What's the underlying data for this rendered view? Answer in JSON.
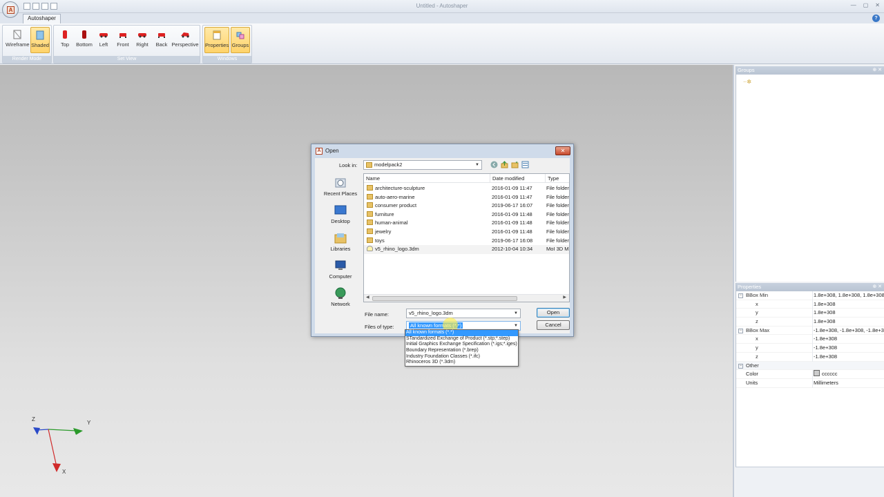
{
  "window": {
    "title": "Untitled - Autoshaper",
    "app_letter": "A"
  },
  "ribbon": {
    "tab": "Autoshaper",
    "groups": [
      {
        "label": "Render Mode",
        "buttons": [
          "Wireframe",
          "Shaded"
        ]
      },
      {
        "label": "Set View",
        "buttons": [
          "Top",
          "Bottom",
          "Left",
          "Front",
          "Right",
          "Back",
          "Perspective"
        ]
      },
      {
        "label": "Windows",
        "buttons": [
          "Properties",
          "Groups"
        ]
      }
    ]
  },
  "panels": {
    "groups_title": "Groups",
    "properties_title": "Properties",
    "properties": [
      {
        "key": "BBox Min",
        "value": "1.8e+308, 1.8e+308, 1.8e+308",
        "level": "cat"
      },
      {
        "key": "x",
        "value": "1.8e+308",
        "level": "sub"
      },
      {
        "key": "y",
        "value": "1.8e+308",
        "level": "sub"
      },
      {
        "key": "z",
        "value": "1.8e+308",
        "level": "sub"
      },
      {
        "key": "BBox Max",
        "value": "-1.8e+308, -1.8e+308, -1.8e+308",
        "level": "cat"
      },
      {
        "key": "x",
        "value": "-1.8e+308",
        "level": "sub"
      },
      {
        "key": "y",
        "value": "-1.8e+308",
        "level": "sub"
      },
      {
        "key": "z",
        "value": "-1.8e+308",
        "level": "sub"
      },
      {
        "key": "Other",
        "value": "",
        "level": "cat"
      },
      {
        "key": "Color",
        "value": "cccccc",
        "level": "plain"
      },
      {
        "key": "Units",
        "value": "Millimeters",
        "level": "plain"
      }
    ]
  },
  "dialog": {
    "title": "Open",
    "look_in_label": "Look in:",
    "look_in_value": "modelpack2",
    "places": [
      "Recent Places",
      "Desktop",
      "Libraries",
      "Computer",
      "Network"
    ],
    "columns": [
      "Name",
      "Date modified",
      "Type"
    ],
    "files": [
      {
        "name": "architecture-sculpture",
        "date": "2016-01-09 11:47",
        "type": "File folder",
        "icon": "folder"
      },
      {
        "name": "auto-aero-marine",
        "date": "2016-01-09 11:47",
        "type": "File folder",
        "icon": "folder"
      },
      {
        "name": "consumer product",
        "date": "2019-06-17 16:07",
        "type": "File folder",
        "icon": "folder"
      },
      {
        "name": "furniture",
        "date": "2016-01-09 11:48",
        "type": "File folder",
        "icon": "folder"
      },
      {
        "name": "human-animal",
        "date": "2016-01-09 11:48",
        "type": "File folder",
        "icon": "folder"
      },
      {
        "name": "jewelry",
        "date": "2016-01-09 11:48",
        "type": "File folder",
        "icon": "folder"
      },
      {
        "name": "toys",
        "date": "2019-06-17 16:08",
        "type": "File folder",
        "icon": "folder"
      },
      {
        "name": "v5_rhino_logo.3dm",
        "date": "2012-10-04 10:34",
        "type": "MoI 3D M",
        "icon": "bulb"
      }
    ],
    "file_name_label": "File name:",
    "file_name_value": "v5_rhino_logo.3dm",
    "file_type_label": "Files of type:",
    "file_type_value": "All known formats (*.*)",
    "open_button": "Open",
    "cancel_button": "Cancel",
    "file_type_options": [
      "All known formats (*.*)",
      "STandardized Exchange of Product (*.stp;*.step)",
      "Initial Graphics Exchange Specification (*.igs;*.iges)",
      "Boundary Representation (*.brep)",
      "Industry Foundation Classes (*.ifc)",
      "Rhinoceros 3D (*.3dm)"
    ]
  },
  "axes": {
    "z": "Z",
    "y": "Y",
    "x": "X"
  }
}
